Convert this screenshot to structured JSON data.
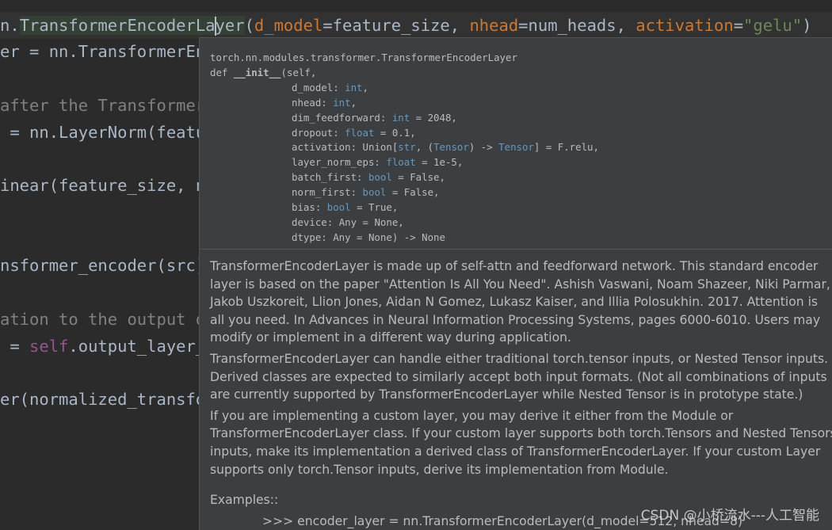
{
  "editor": {
    "line1": {
      "prefix": "n.",
      "class_before_caret": "TransformerEncoderLa",
      "class_after_caret": "yer",
      "open": "(",
      "p1": "d_model",
      "v1": "=feature_size, ",
      "p2": "nhead",
      "v2": "=num_heads, ",
      "p3": "activation",
      "eq3": "=",
      "s3": "\"gelu\"",
      "close": ")"
    },
    "line2": "er = nn.TransformerEn",
    "line3": "after the Transformer",
    "line4": " = nn.LayerNorm(featu",
    "line5": "inear(feature_size, n",
    "line6": "nsformer_encoder(src)",
    "line7": "ation to the output o",
    "line8": {
      "eq": " = ",
      "self": "self",
      "rest": ".output_layer_"
    },
    "line9": "er(normalized_transfo"
  },
  "popup": {
    "sig": {
      "qualname": "torch.nn.modules.transformer.TransformerEncoderLayer",
      "def_kw": "def ",
      "init_name": "__init__",
      "self_part": "(self,",
      "params": [
        {
          "name": "d_model: ",
          "type": "int",
          "suffix": ","
        },
        {
          "name": "nhead: ",
          "type": "int",
          "suffix": ","
        },
        {
          "name": "dim_feedforward: ",
          "type": "int",
          "suffix": " = 2048,"
        },
        {
          "name": "dropout: ",
          "type": "float",
          "suffix": " = 0.1,"
        },
        {
          "name": "activation: ",
          "union_open": "Union[",
          "type": "str",
          "mid": ", (",
          "type2": "Tensor",
          "arrow": ") -> ",
          "type3": "Tensor",
          "suffix": "] = F.relu,"
        },
        {
          "name": "layer_norm_eps: ",
          "type": "float",
          "suffix": " = 1e-5,"
        },
        {
          "name": "batch_first: ",
          "type": "bool",
          "suffix": " = False,"
        },
        {
          "name": "norm_first: ",
          "type": "bool",
          "suffix": " = False,"
        },
        {
          "name": "bias: ",
          "type": "bool",
          "suffix": " = True,"
        },
        {
          "name": "device: ",
          "type": "",
          "suffix": "Any = None,"
        },
        {
          "name": "dtype: ",
          "type": "",
          "suffix": "Any = None) -> None"
        }
      ]
    },
    "doc": {
      "p1": [
        "TransformerEncoderLayer is made up of self-attn and feedforward network. This standard encoder",
        "layer is based on the paper \"Attention Is All You Need\". Ashish Vaswani, Noam Shazeer, Niki Parmar,",
        "Jakob Uszkoreit, Llion Jones, Aidan N Gomez, Lukasz Kaiser, and Illia Polosukhin. 2017. Attention is",
        "all you need. In Advances in Neural Information Processing Systems, pages 6000-6010. Users may",
        "modify or implement in a different way during application."
      ],
      "p2": [
        "TransformerEncoderLayer can handle either traditional torch.tensor inputs, or Nested Tensor inputs.",
        "Derived classes are expected to similarly accept both input formats. (Not all combinations of inputs",
        "are currently supported by TransformerEncoderLayer while Nested Tensor is in prototype state.)"
      ],
      "p3": [
        "If you are implementing a custom layer, you may derive it either from the Module or",
        "TransformerEncoderLayer class. If your custom layer supports both torch.Tensors and Nested Tensors",
        "inputs, make its implementation a derived class of TransformerEncoderLayer. If your custom Layer",
        "supports only torch.Tensor inputs, derive its implementation from Module."
      ],
      "examples_label": "Examples::",
      "example_code": ">>> encoder_layer = nn.TransformerEncoderLayer(d_model=512, nhead=8)"
    }
  },
  "watermark": "CSDN @小桥流水---人工智能",
  "colors": {
    "editor_bg": "#2b2b2b",
    "popup_bg": "#3c3f41",
    "keyword_orange": "#cc7832",
    "string_green": "#6a8759",
    "type_blue": "#6897bb",
    "self_purple": "#94558d",
    "comment_gray": "#808080"
  }
}
